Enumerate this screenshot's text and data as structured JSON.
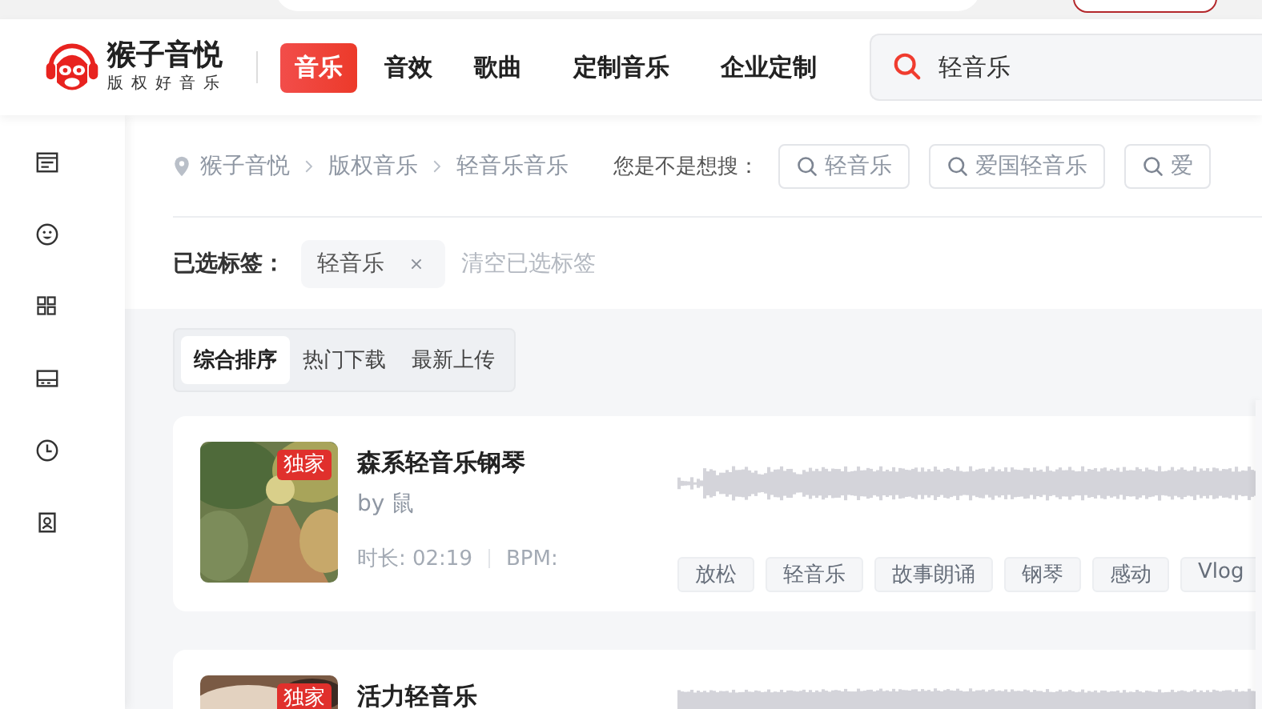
{
  "brand": {
    "name": "猴子音悦",
    "slogan": "版权好音乐"
  },
  "nav": [
    {
      "label": "音乐",
      "selected": true
    },
    {
      "label": "音效",
      "selected": false
    },
    {
      "label": "歌曲",
      "selected": false
    },
    {
      "label": "定制音乐",
      "selected": false
    },
    {
      "label": "企业定制",
      "selected": false
    }
  ],
  "search": {
    "value": "轻音乐"
  },
  "sidebar": {
    "items": [
      {
        "kind": "news"
      },
      {
        "kind": "smile"
      },
      {
        "kind": "grid"
      },
      {
        "kind": "card"
      },
      {
        "kind": "clock"
      },
      {
        "kind": "user"
      }
    ]
  },
  "breadcrumb": [
    "猴子音悦",
    "版权音乐",
    "轻音乐音乐"
  ],
  "suggestions": {
    "label": "您是不是想搜：",
    "items": [
      "轻音乐",
      "爱国轻音乐",
      "爱"
    ]
  },
  "selected_tags": {
    "label": "已选标签：",
    "tags": [
      "轻音乐"
    ],
    "clear": "清空已选标签"
  },
  "sort_tabs": [
    {
      "label": "综合排序",
      "selected": true
    },
    {
      "label": "热门下载",
      "selected": false
    },
    {
      "label": "最新上传",
      "selected": false
    }
  ],
  "tracks": [
    {
      "badge": "独家",
      "title": "森系轻音乐钢琴",
      "author": "by 鼠",
      "duration": "时长: 02:19",
      "bpm": "BPM:",
      "tags": [
        "放松",
        "轻音乐",
        "故事朗诵",
        "钢琴",
        "感动",
        "Vlog"
      ]
    },
    {
      "badge": "独家",
      "title": "活力轻音乐"
    }
  ]
}
